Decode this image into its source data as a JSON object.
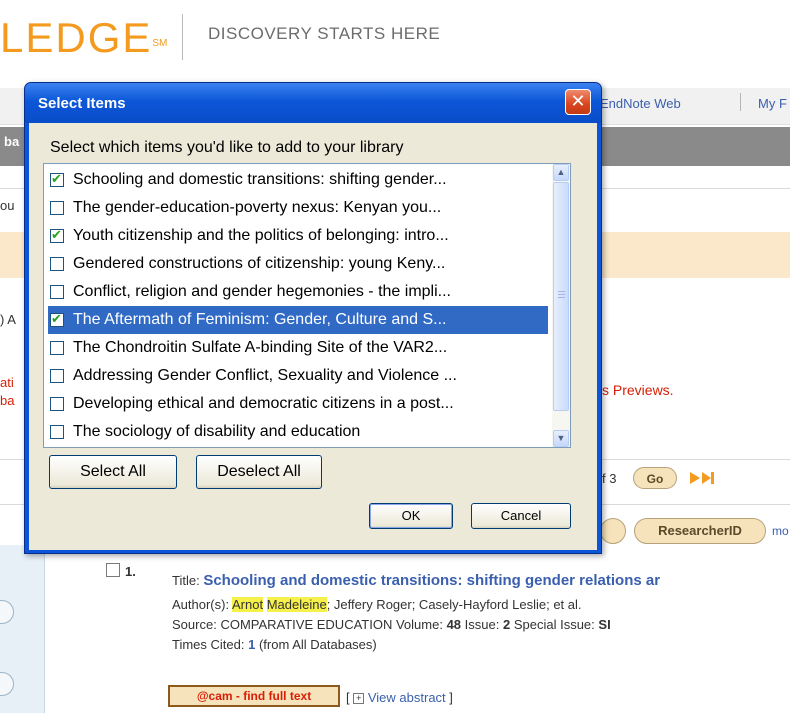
{
  "header": {
    "logo_text": "LEDGE",
    "logo_mark": "SM",
    "tagline": "DISCOVERY STARTS HERE"
  },
  "top_links": {
    "endnote": "EndNote Web",
    "my_prefix": "My F"
  },
  "left_fragments": [
    "ba",
    "ou",
    ") A",
    "ati",
    "ba"
  ],
  "previews_text": "s Previews.",
  "pagination": {
    "of_text": "f 3",
    "go_label": "Go"
  },
  "toolbar": {
    "researcherid_label": "ResearcherID",
    "more_text": "mo"
  },
  "record": {
    "number": "1.",
    "title_label": "Title:",
    "title": "Schooling and domestic transitions: shifting gender relations ar",
    "authors_label": "Author(s):",
    "author_highlight_1": "Arnot",
    "author_highlight_2": "Madeleine",
    "authors_rest": "; Jeffery Roger; Casely-Hayford Leslie; et al.",
    "source_label": "Source:",
    "source": "COMPARATIVE EDUCATION",
    "volume_label": "Volume:",
    "volume": "48",
    "issue_label": "Issue:",
    "issue": "2",
    "special_issue_label": "Special Issue:",
    "special_issue": "SI",
    "times_cited_label": "Times Cited:",
    "times_cited": "1",
    "times_cited_note": "(from All Databases)",
    "full_text_button": "@cam - find full text",
    "view_abstract": "View abstract"
  },
  "dialog": {
    "title": "Select Items",
    "close_symbol": "✕",
    "instruction": "Select which items you'd like to add to your library",
    "items": [
      {
        "label": "Schooling and domestic transitions: shifting gender...",
        "checked": true,
        "selected": false
      },
      {
        "label": "The gender-education-poverty nexus: Kenyan you...",
        "checked": false,
        "selected": false
      },
      {
        "label": "Youth citizenship and the politics of belonging: intro...",
        "checked": true,
        "selected": false
      },
      {
        "label": "Gendered constructions of citizenship: young Keny...",
        "checked": false,
        "selected": false
      },
      {
        "label": "Conflict, religion and gender hegemonies - the impli...",
        "checked": false,
        "selected": false
      },
      {
        "label": "The Aftermath of Feminism: Gender, Culture and S...",
        "checked": true,
        "selected": true
      },
      {
        "label": "The Chondroitin Sulfate A-binding Site of the VAR2...",
        "checked": false,
        "selected": false
      },
      {
        "label": "Addressing Gender Conflict, Sexuality and Violence ...",
        "checked": false,
        "selected": false
      },
      {
        "label": "Developing ethical and democratic citizens in a post...",
        "checked": false,
        "selected": false
      },
      {
        "label": "The sociology of disability and education",
        "checked": false,
        "selected": false
      }
    ],
    "select_all": "Select All",
    "deselect_all": "Deselect All",
    "ok": "OK",
    "cancel": "Cancel"
  },
  "colors": {
    "logo": "#f39a1f",
    "link": "#3a5fae",
    "dialog_title": "#0a55d8",
    "selection": "#316ac5",
    "highlight": "#f6f04a",
    "alert_red": "#d81e05"
  }
}
